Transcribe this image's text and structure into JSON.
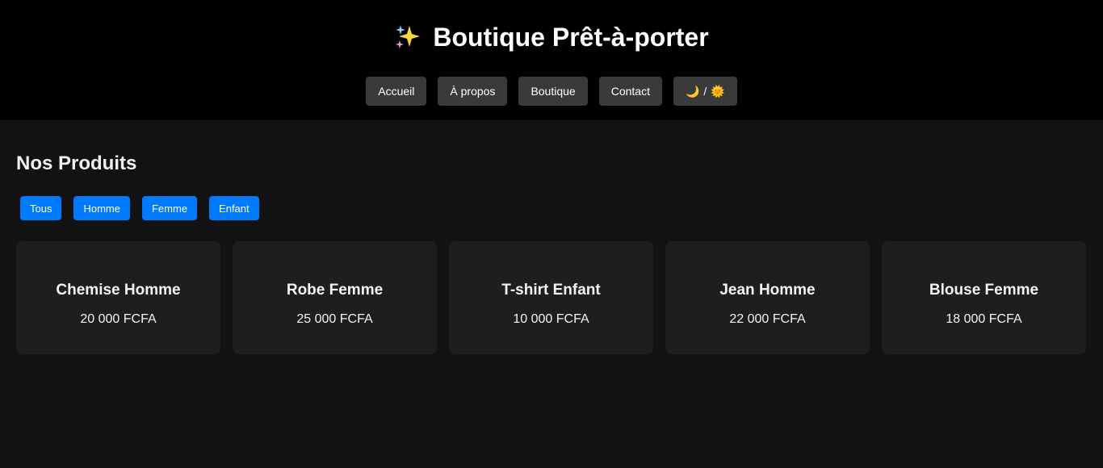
{
  "header": {
    "icon": "sparkles-icon",
    "title": "Boutique Prêt-à-porter"
  },
  "nav": {
    "items": [
      {
        "label": "Accueil"
      },
      {
        "label": "À propos"
      },
      {
        "label": "Boutique"
      },
      {
        "label": "Contact"
      }
    ],
    "theme_toggle": {
      "moon_icon": "🌙",
      "separator": "/",
      "sun_icon": "🌞"
    }
  },
  "products_section": {
    "title": "Nos Produits",
    "filters": [
      {
        "label": "Tous"
      },
      {
        "label": "Homme"
      },
      {
        "label": "Femme"
      },
      {
        "label": "Enfant"
      }
    ],
    "items": [
      {
        "name": "Chemise Homme",
        "price": "20 000 FCFA"
      },
      {
        "name": "Robe Femme",
        "price": "25 000 FCFA"
      },
      {
        "name": "T-shirt Enfant",
        "price": "10 000 FCFA"
      },
      {
        "name": "Jean Homme",
        "price": "22 000 FCFA"
      },
      {
        "name": "Blouse Femme",
        "price": "18 000 FCFA"
      }
    ]
  },
  "colors": {
    "header_bg": "#000000",
    "page_bg": "#121212",
    "card_bg": "#1e1e1e",
    "nav_button_bg": "#3a3a3a",
    "filter_accent": "#007bff"
  }
}
